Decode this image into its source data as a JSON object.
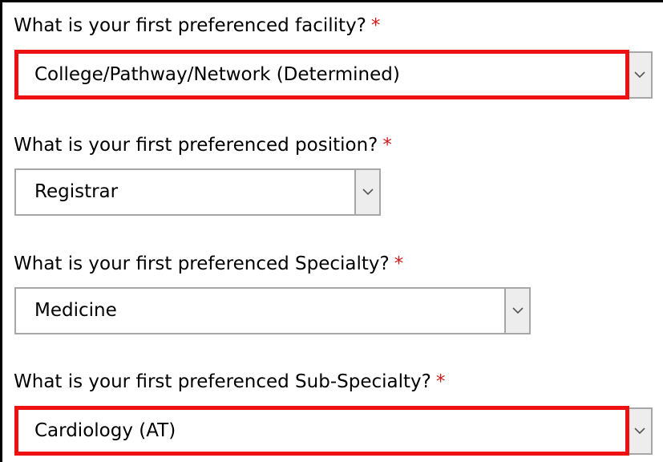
{
  "required_marker": "*",
  "colors": {
    "required_marker": "#d11a1a",
    "highlight_box": "#ee1111",
    "select_border": "#a7a7a7",
    "select_button": "#ededed"
  },
  "form": {
    "facility": {
      "label": "What is your first preferenced facility?",
      "value": "College/Pathway/Network (Determined)",
      "icon": "chevron-down-icon",
      "highlighted": true
    },
    "position": {
      "label": "What is your first preferenced position?",
      "value": "Registrar",
      "icon": "chevron-down-icon",
      "highlighted": false
    },
    "specialty": {
      "label": "What is your first preferenced Specialty?",
      "value": "Medicine",
      "icon": "chevron-down-icon",
      "highlighted": false
    },
    "subspecialty": {
      "label": "What is your first preferenced Sub-Specialty?",
      "value": "Cardiology (AT)",
      "icon": "chevron-down-icon",
      "highlighted": true
    }
  }
}
